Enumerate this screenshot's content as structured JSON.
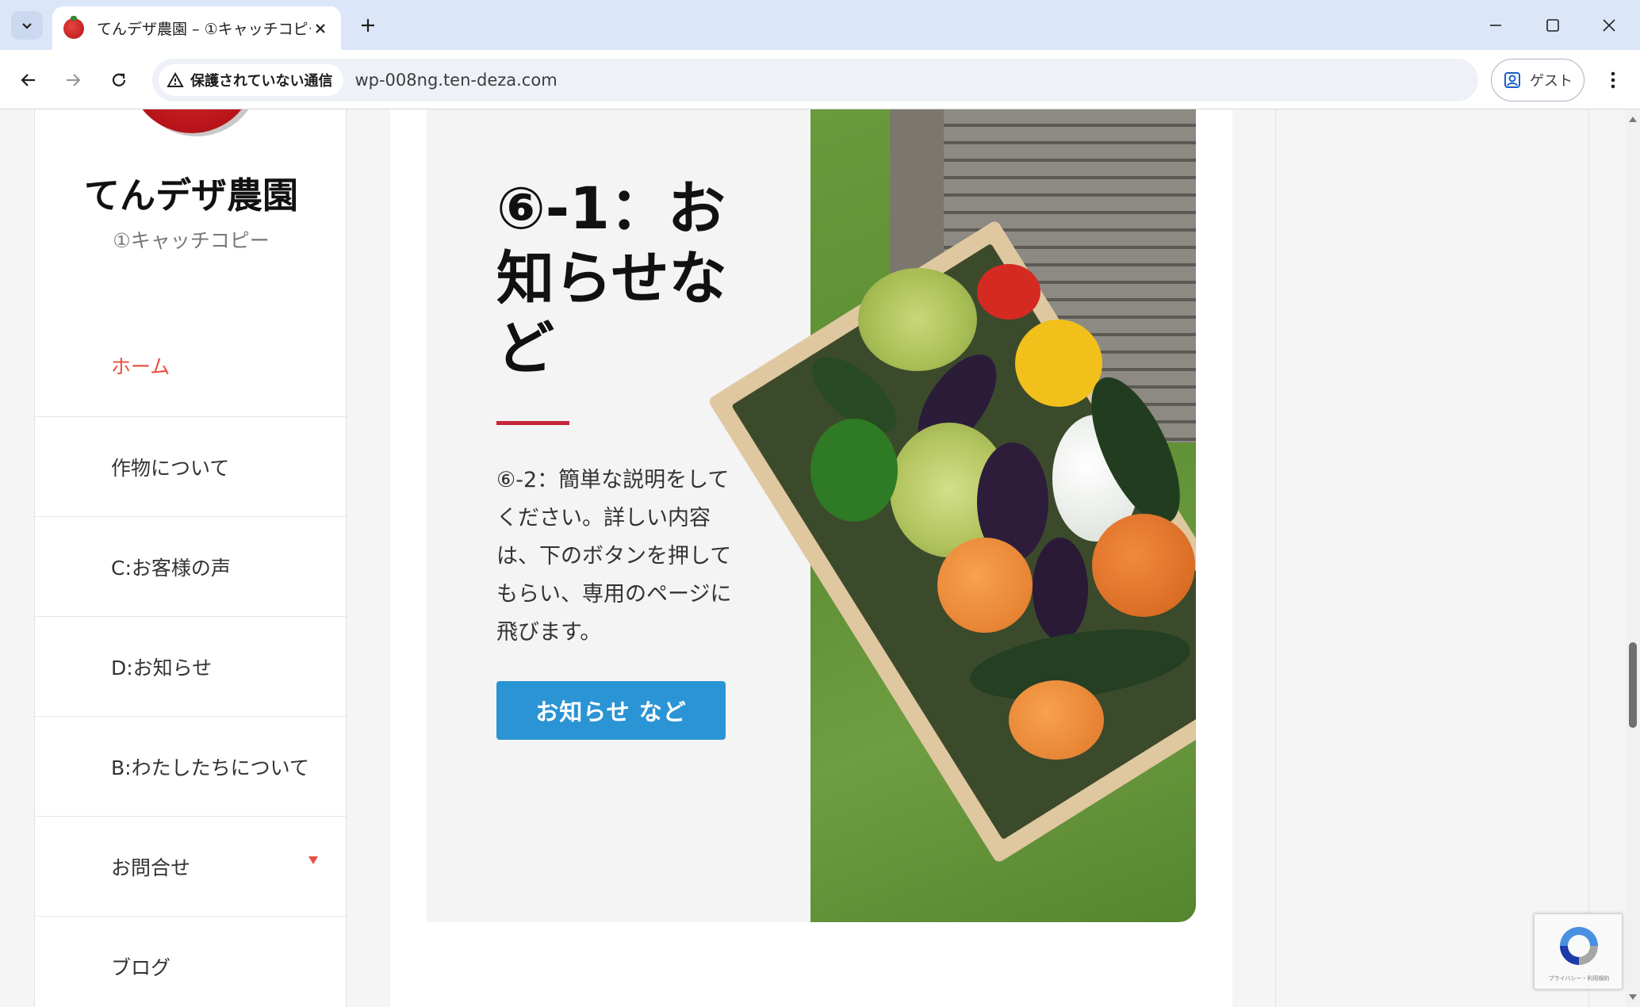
{
  "browser": {
    "tab_title": "てんデザ農園 – ①キャッチコピー",
    "security_label": "保護されていない通信",
    "url": "wp-008ng.ten-deza.com",
    "profile_label": "ゲスト"
  },
  "site": {
    "title": "てんデザ農園",
    "tagline": "①キャッチコピー"
  },
  "sidebar": {
    "items": [
      {
        "label": "ホーム",
        "active": true
      },
      {
        "label": "作物について"
      },
      {
        "label": "C:お客様の声"
      },
      {
        "label": "D:お知らせ"
      },
      {
        "label": "B:わたしたちについて"
      },
      {
        "label": "お問合せ",
        "has_submenu": true
      },
      {
        "label": "ブログ"
      }
    ]
  },
  "feature": {
    "heading": "⑥-1：お知らせなど",
    "description": "⑥-2：簡単な説明をしてください。詳しい内容は、下のボタンを押してもらい、専用のページに飛びます。",
    "button_label": "お知らせ など"
  },
  "recaptcha": {
    "text": "プライバシー・利用規約"
  },
  "colors": {
    "accent": "#e8503f",
    "rule": "#c62638",
    "button": "#2b94d4",
    "tab_bar": "#dbe6f8"
  }
}
